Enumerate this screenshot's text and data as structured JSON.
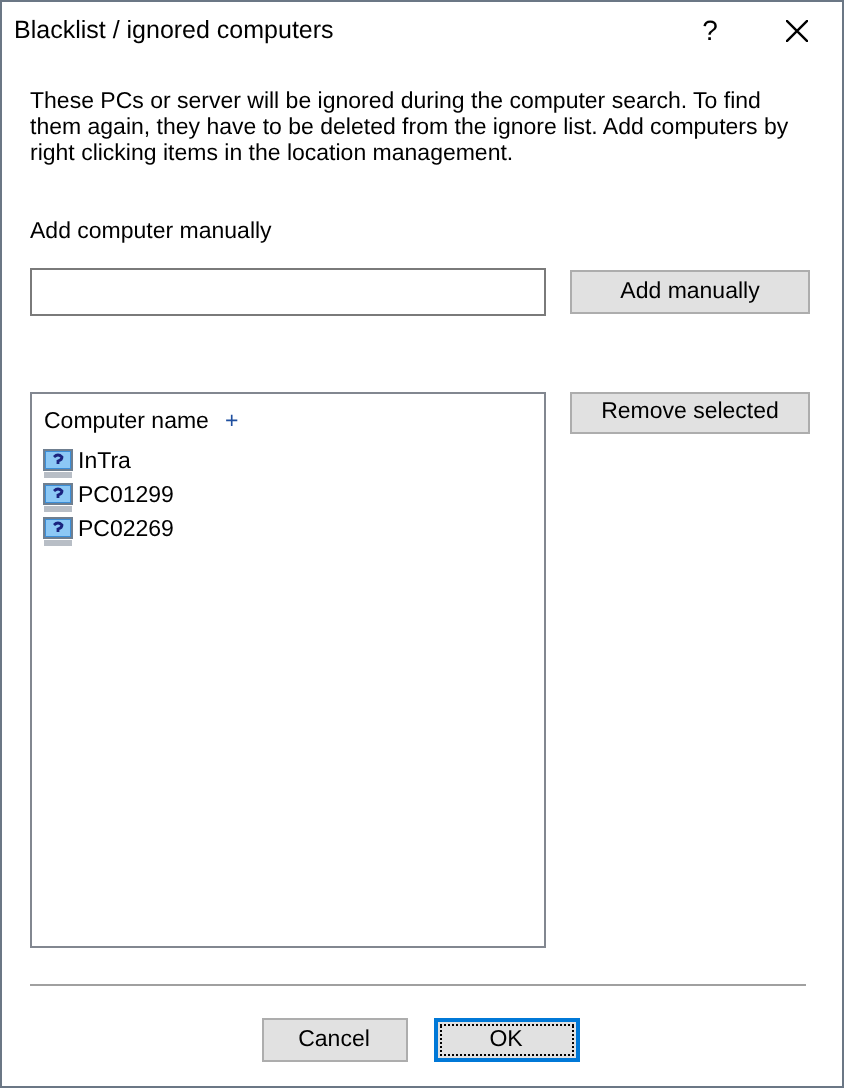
{
  "window": {
    "title": "Blacklist / ignored computers",
    "help": "?"
  },
  "description": "These PCs or server will be ignored during the computer search. To find them again, they have to be deleted from the ignore list. Add computers by right clicking items in the location management.",
  "manual": {
    "label": "Add computer manually",
    "button": "Add manually"
  },
  "list": {
    "column": "Computer name",
    "sort_mark": "+",
    "items": [
      {
        "name": "InTra"
      },
      {
        "name": "PC01299"
      },
      {
        "name": "PC02269"
      }
    ]
  },
  "remove_button": "Remove selected",
  "buttons": [
    {
      "label": "Cancel",
      "default": false
    },
    {
      "label": "OK",
      "default": true
    }
  ]
}
